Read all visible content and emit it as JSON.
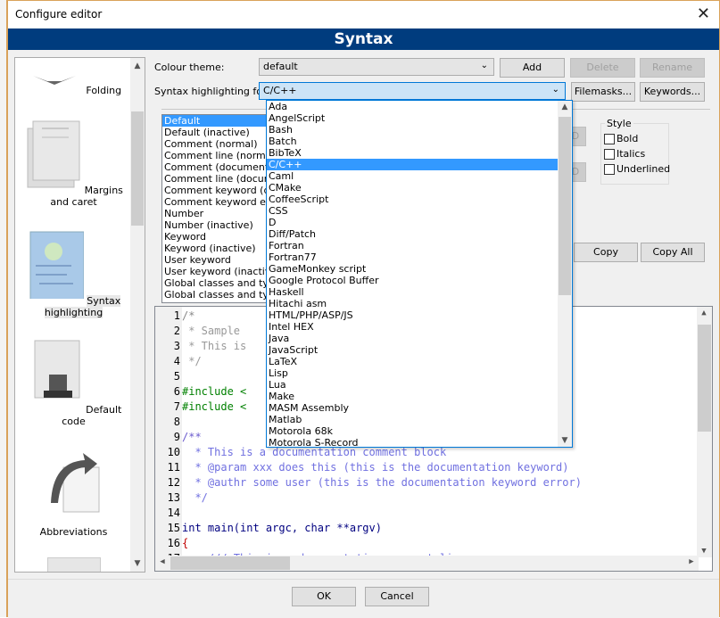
{
  "window": {
    "title": "Configure editor",
    "close": "✕"
  },
  "header": {
    "title": "Syntax"
  },
  "sidebar": {
    "items": [
      {
        "label": "Folding",
        "icon": "folding-icon"
      },
      {
        "label": "Margins and caret",
        "icon": "margins-icon"
      },
      {
        "label": "Syntax highlighting",
        "icon": "syntax-icon",
        "selected": true
      },
      {
        "label": "Default code",
        "icon": "default-code-icon"
      },
      {
        "label": "Abbreviations",
        "icon": "abbreviations-icon"
      }
    ]
  },
  "theme": {
    "label": "Colour theme:",
    "value": "default",
    "add": "Add",
    "delete": "Delete",
    "rename": "Rename"
  },
  "syntax": {
    "label": "Syntax highlighting for:",
    "value": "C/C++",
    "filemasks": "Filemasks...",
    "keywords": "Keywords..."
  },
  "styles": [
    "Default",
    "Default (inactive)",
    "Comment (normal)",
    "Comment line (normal)",
    "Comment (documentation)",
    "Comment line (documentation)",
    "Comment keyword (documentation)",
    "Comment keyword error (documentation)",
    "Number",
    "Number (inactive)",
    "Keyword",
    "Keyword (inactive)",
    "User keyword",
    "User keyword (inactive)",
    "Global classes and typedefs",
    "Global classes and typedefs (inactive)"
  ],
  "style_group": {
    "title": "Style",
    "bold": "Bold",
    "italics": "Italics",
    "underlined": "Underlined"
  },
  "partial_buttons": {
    "d1": "D",
    "d2": "D"
  },
  "copy": {
    "copy": "Copy",
    "copy_all": "Copy All"
  },
  "languages": [
    "Ada",
    "AngelScript",
    "Bash",
    "Batch",
    "BibTeX",
    "C/C++",
    "Caml",
    "CMake",
    "CoffeeScript",
    "CSS",
    "D",
    "Diff/Patch",
    "Fortran",
    "Fortran77",
    "GameMonkey script",
    "Google Protocol Buffer",
    "Haskell",
    "Hitachi asm",
    "HTML/PHP/ASP/JS",
    "Intel HEX",
    "Java",
    "JavaScript",
    "LaTeX",
    "Lisp",
    "Lua",
    "Make",
    "MASM Assembly",
    "Matlab",
    "Motorola 68k",
    "Motorola S-Record"
  ],
  "code": [
    {
      "n": "1",
      "t": "/*",
      "c": "#888"
    },
    {
      "n": "2",
      "t": " * Sample",
      "c": "#999"
    },
    {
      "n": "3",
      "t": " * This is",
      "c": "#999"
    },
    {
      "n": "4",
      "t": " */",
      "c": "#999"
    },
    {
      "n": "5",
      "t": "",
      "c": "#000"
    },
    {
      "n": "6",
      "t": "#include <",
      "c": "#008000"
    },
    {
      "n": "7",
      "t": "#include <",
      "c": "#008000"
    },
    {
      "n": "8",
      "t": "",
      "c": "#000"
    },
    {
      "n": "9",
      "t": "/**",
      "c": "#6a5acd"
    },
    {
      "n": "10",
      "t": "  * This is a documentation comment block",
      "c": "#7070e0"
    },
    {
      "n": "11",
      "t": "  * @param xxx does this (this is the documentation keyword)",
      "c": "#7070e0"
    },
    {
      "n": "12",
      "t": "  * @authr some user (this is the documentation keyword error)",
      "c": "#7070e0"
    },
    {
      "n": "13",
      "t": "  */",
      "c": "#7070e0"
    },
    {
      "n": "14",
      "t": "",
      "c": "#000"
    },
    {
      "n": "15",
      "t": "int main(int argc, char **argv)",
      "c": "#000080"
    },
    {
      "n": "16",
      "t": "{",
      "c": "#c00000"
    },
    {
      "n": "17",
      "t": "    /// This is a documentation comment line",
      "c": "#7070e0"
    }
  ],
  "footer": {
    "ok": "OK",
    "cancel": "Cancel"
  },
  "colors": {
    "header": "#003c7e",
    "selection": "#3399ff"
  }
}
